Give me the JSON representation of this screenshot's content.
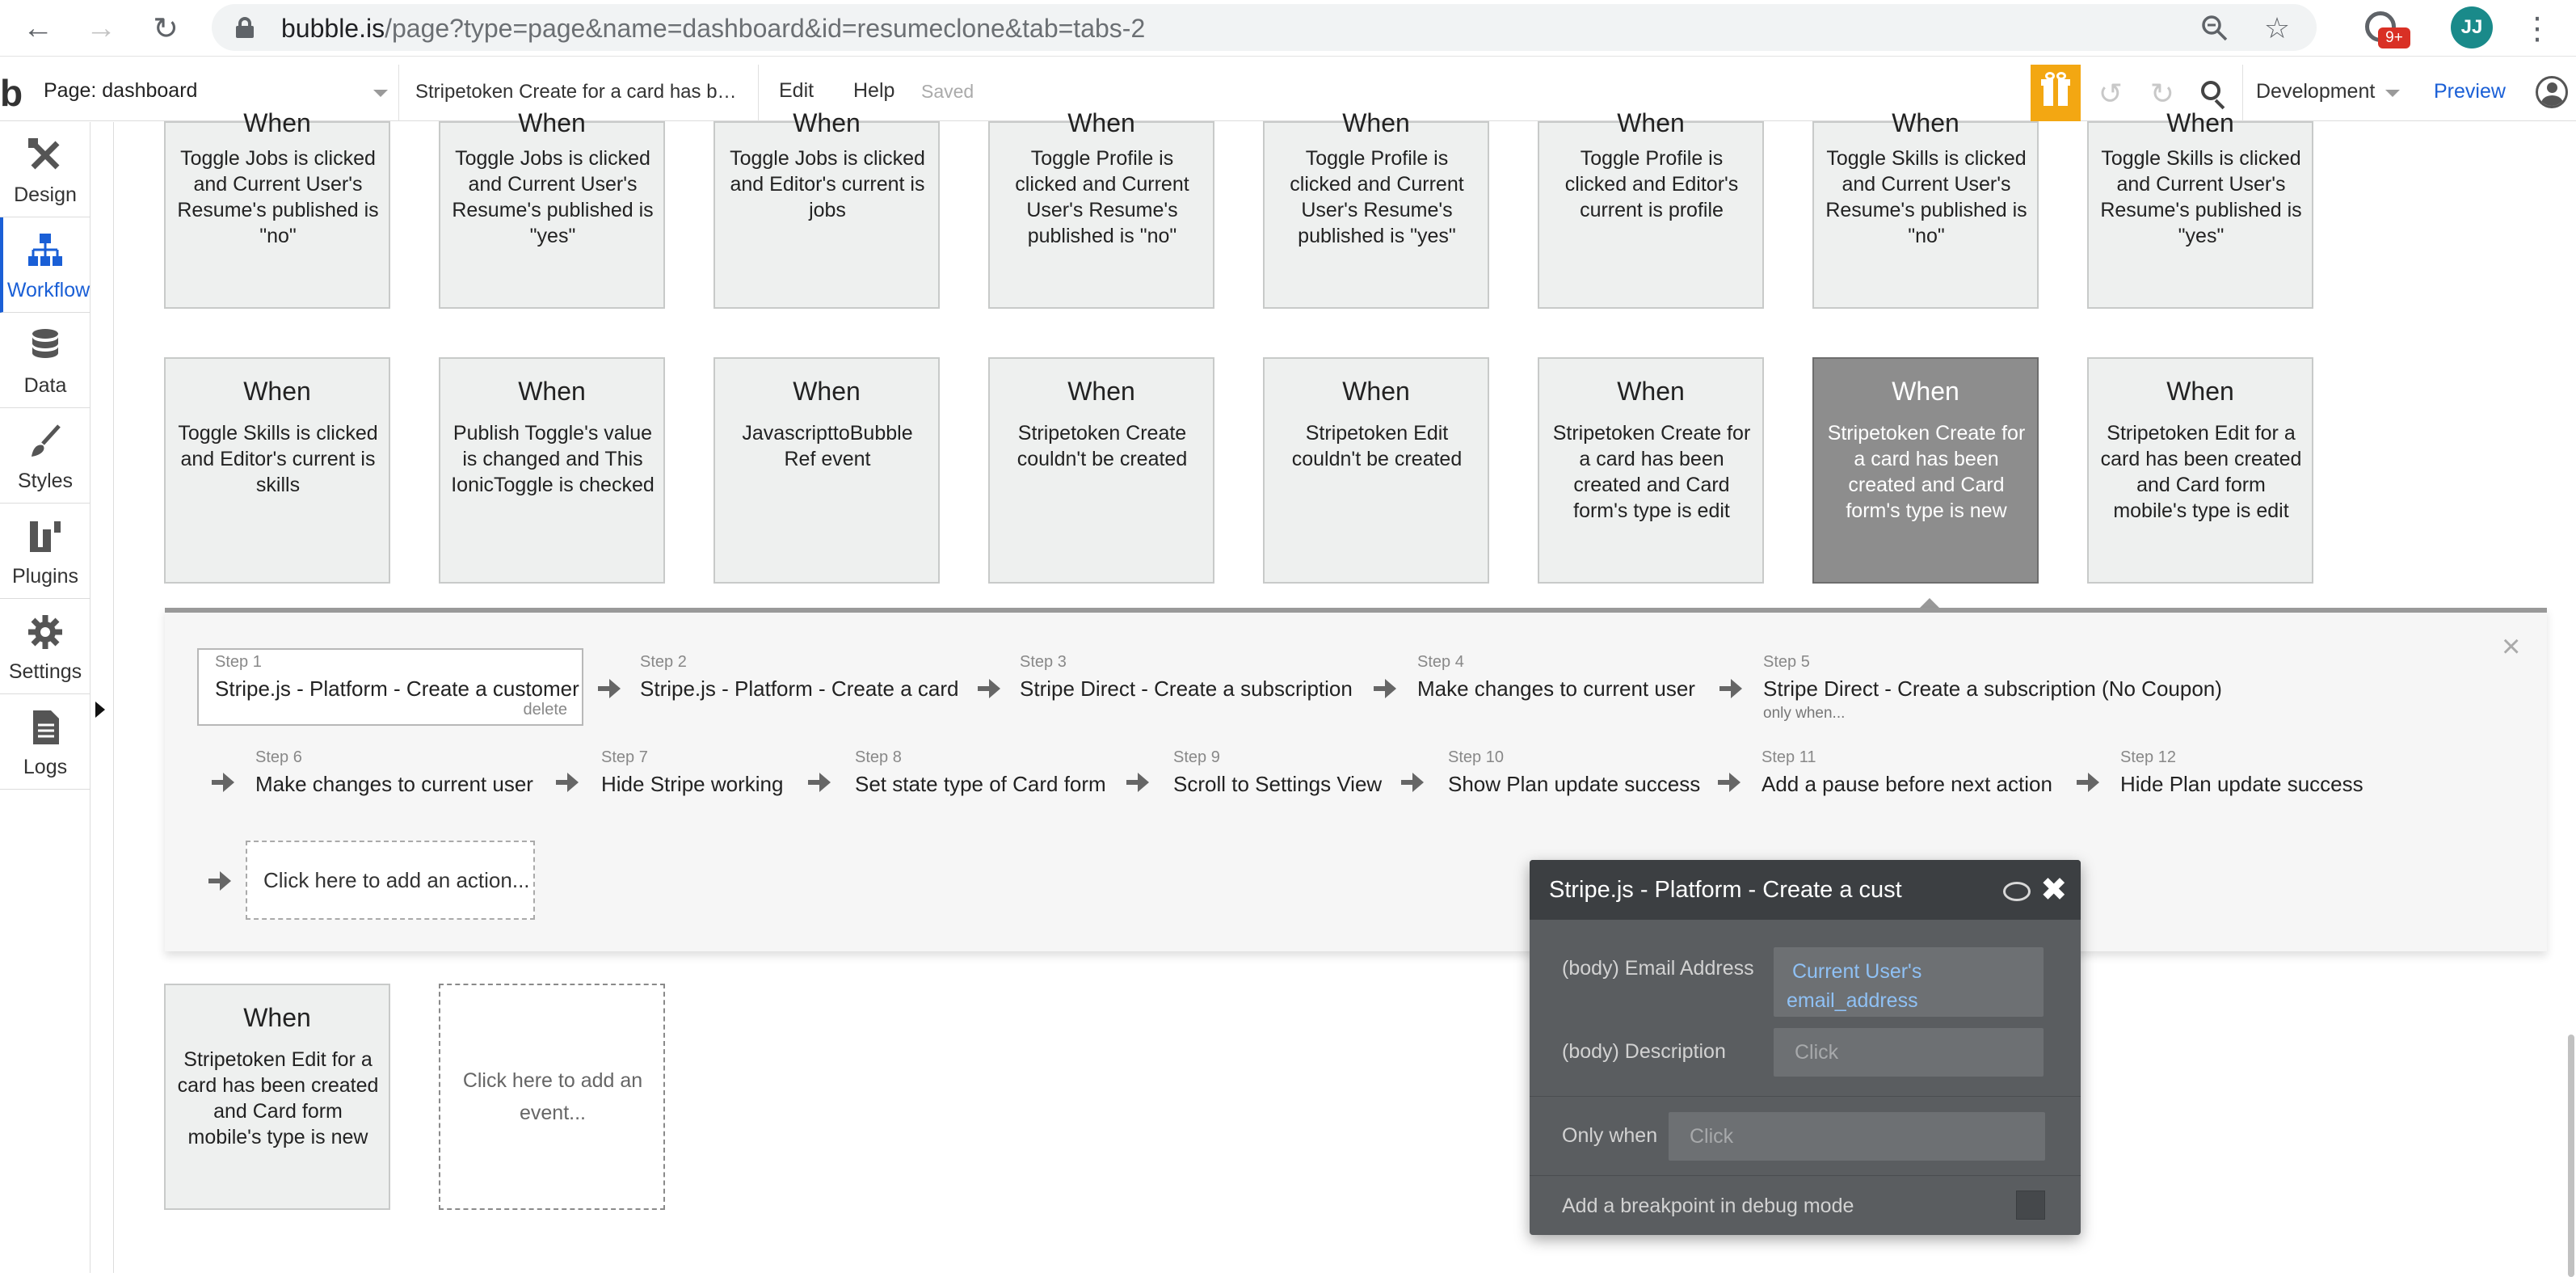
{
  "browser": {
    "url_host": "bubble.is",
    "url_path": "/page?type=page&name=dashboard&id=resumeclone&tab=tabs-2",
    "extension_badge": "9+",
    "profile_initials": "JJ"
  },
  "header": {
    "page_selector": "Page: dashboard",
    "workflow_selector": "Stripetoken Create for a card has been created",
    "menu_edit": "Edit",
    "menu_help": "Help",
    "status": "Saved",
    "environment": "Development",
    "preview": "Preview"
  },
  "sidebar": {
    "items": [
      {
        "label": "Design"
      },
      {
        "label": "Workflow"
      },
      {
        "label": "Data"
      },
      {
        "label": "Styles"
      },
      {
        "label": "Plugins"
      },
      {
        "label": "Settings"
      },
      {
        "label": "Logs"
      }
    ]
  },
  "events": {
    "row1": [
      {
        "title": "When",
        "desc": "Toggle Jobs is clicked and Current User's Resume's published is \"no\""
      },
      {
        "title": "When",
        "desc": "Toggle Jobs is clicked and Current User's Resume's published is \"yes\""
      },
      {
        "title": "When",
        "desc": "Toggle Jobs is clicked and Editor's current is jobs"
      },
      {
        "title": "When",
        "desc": "Toggle Profile is clicked and Current User's Resume's published is \"no\""
      },
      {
        "title": "When",
        "desc": "Toggle Profile is clicked and Current User's Resume's published is \"yes\""
      },
      {
        "title": "When",
        "desc": "Toggle Profile is clicked and Editor's current is profile"
      },
      {
        "title": "When",
        "desc": "Toggle Skills is clicked and Current User's Resume's published is \"no\""
      },
      {
        "title": "When",
        "desc": "Toggle Skills is clicked and Current User's Resume's published is \"yes\""
      }
    ],
    "row2": [
      {
        "title": "When",
        "desc": "Toggle Skills is clicked and Editor's current is skills"
      },
      {
        "title": "When",
        "desc": "Publish Toggle's value is changed and This IonicToggle is checked"
      },
      {
        "title": "When",
        "desc": "JavascripttoBubble Ref event"
      },
      {
        "title": "When",
        "desc": "Stripetoken Create couldn't be created"
      },
      {
        "title": "When",
        "desc": "Stripetoken Edit couldn't be created"
      },
      {
        "title": "When",
        "desc": "Stripetoken Create for a card has been created and Card form's type is edit"
      },
      {
        "title": "When",
        "desc": "Stripetoken Create for a card has been created and Card form's type is new"
      },
      {
        "title": "When",
        "desc": "Stripetoken Edit for a card has been created and Card form mobile's type is edit"
      }
    ],
    "row3": [
      {
        "title": "When",
        "desc": "Stripetoken Edit for a card has been created and Card form mobile's type is new"
      }
    ],
    "add_event": "Click here to add an event..."
  },
  "workflow": {
    "steps": [
      {
        "num": "Step 1",
        "title": "Stripe.js - Platform - Create a customer",
        "action": "delete"
      },
      {
        "num": "Step 2",
        "title": "Stripe.js - Platform - Create a card"
      },
      {
        "num": "Step 3",
        "title": "Stripe Direct - Create a subscription"
      },
      {
        "num": "Step 4",
        "title": "Make changes to current user"
      },
      {
        "num": "Step 5",
        "title": "Stripe Direct - Create a subscription (No Coupon)",
        "note": "only when..."
      },
      {
        "num": "Step 6",
        "title": "Make changes to current user"
      },
      {
        "num": "Step 7",
        "title": "Hide Stripe working"
      },
      {
        "num": "Step 8",
        "title": "Set state type of Card form"
      },
      {
        "num": "Step 9",
        "title": "Scroll to Settings View"
      },
      {
        "num": "Step 10",
        "title": "Show Plan update success"
      },
      {
        "num": "Step 11",
        "title": "Add a pause before next action"
      },
      {
        "num": "Step 12",
        "title": "Hide Plan update success"
      }
    ],
    "add_action": "Click here to add an action..."
  },
  "property_editor": {
    "title": "Stripe.js - Platform - Create a cust",
    "email_label": "(body) Email Address",
    "email_value_line1": "Current User's",
    "email_value_line2": "email_address",
    "description_label": "(body) Description",
    "description_placeholder": "Click",
    "only_when_label": "Only when",
    "only_when_placeholder": "Click",
    "breakpoint_label": "Add a breakpoint in debug mode",
    "breakpoint_checked": false
  }
}
